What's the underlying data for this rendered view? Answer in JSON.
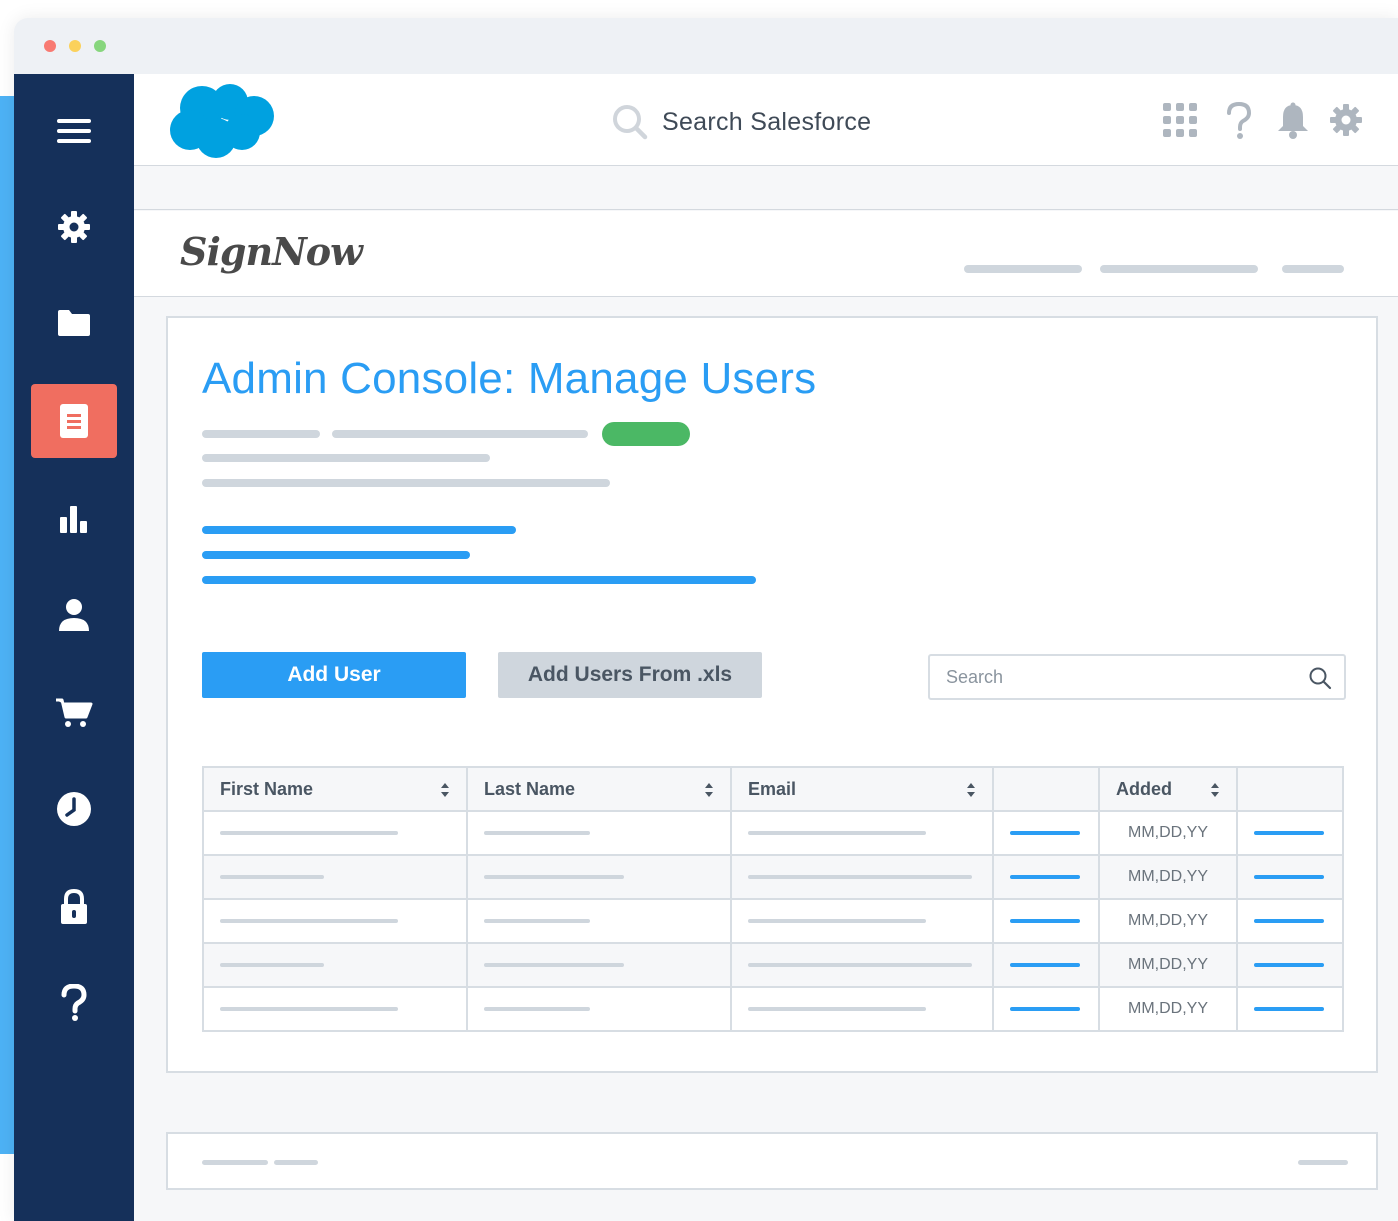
{
  "window": {
    "controls": [
      "close",
      "minimize",
      "maximize"
    ]
  },
  "sidebar": {
    "items": [
      {
        "name": "menu",
        "icon": "hamburger-icon"
      },
      {
        "name": "settings",
        "icon": "gear-icon"
      },
      {
        "name": "folder",
        "icon": "folder-icon"
      },
      {
        "name": "documents",
        "icon": "document-icon",
        "active": true
      },
      {
        "name": "reports",
        "icon": "bar-chart-icon"
      },
      {
        "name": "user",
        "icon": "user-icon"
      },
      {
        "name": "cart",
        "icon": "cart-icon"
      },
      {
        "name": "history",
        "icon": "clock-icon"
      },
      {
        "name": "security",
        "icon": "lock-icon"
      },
      {
        "name": "help",
        "icon": "question-icon"
      }
    ]
  },
  "topbar": {
    "logo_icon": "salesforce-cloud-logo",
    "search_label": "Search Salesforce",
    "icons": [
      "app-launcher-icon",
      "help-icon",
      "bell-icon",
      "gear-icon"
    ]
  },
  "brand": {
    "name": "SignNow"
  },
  "main": {
    "title": "Admin Console: Manage Users",
    "add_user_label": "Add User",
    "add_users_xls_label": "Add Users From .xls",
    "search_placeholder": "Search"
  },
  "table": {
    "columns": [
      "First Name",
      "Last Name",
      "Email",
      "",
      "Added",
      ""
    ],
    "rows": [
      {
        "added": "MM,DD,YY"
      },
      {
        "added": "MM,DD,YY"
      },
      {
        "added": "MM,DD,YY"
      },
      {
        "added": "MM,DD,YY"
      },
      {
        "added": "MM,DD,YY"
      }
    ]
  },
  "colors": {
    "sidebar": "#15305a",
    "accent_blue": "#2a9df4",
    "active_item": "#f06e60",
    "status_green": "#4bb865",
    "placeholder_gray": "#cfd6dd"
  }
}
